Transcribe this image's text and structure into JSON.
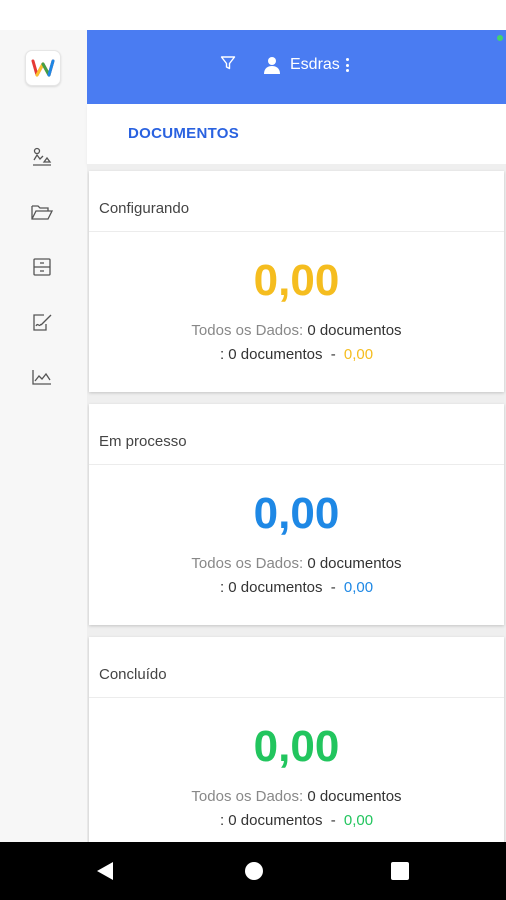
{
  "header": {
    "user_name": "Esdras"
  },
  "tabs": [
    {
      "label": "DOCUMENTOS"
    }
  ],
  "cards": [
    {
      "title": "Configurando",
      "value": "0,00",
      "all_data_label": "Todos os Dados:",
      "all_data_count": "0 documentos",
      "prefix": ":",
      "count": "0 documentos",
      "separator": "-",
      "small_value": "0,00",
      "color": "#f5bd1f"
    },
    {
      "title": "Em processo",
      "value": "0,00",
      "all_data_label": "Todos os Dados:",
      "all_data_count": "0 documentos",
      "prefix": ":",
      "count": "0 documentos",
      "separator": "-",
      "small_value": "0,00",
      "color": "#1e88e5"
    },
    {
      "title": "Concluído",
      "value": "0,00",
      "all_data_label": "Todos os Dados:",
      "all_data_count": "0 documentos",
      "prefix": ":",
      "count": "0 documentos",
      "separator": "-",
      "small_value": "0,00",
      "color": "#22c55e"
    }
  ],
  "sidebar": {
    "icons": [
      "workflow-icon",
      "folder-open-icon",
      "archive-icon",
      "signature-icon",
      "chart-icon"
    ]
  },
  "colors": {
    "topbar": "#4a7cf2",
    "tab_active": "#2a62e0",
    "status_dot": "#43d36b"
  }
}
